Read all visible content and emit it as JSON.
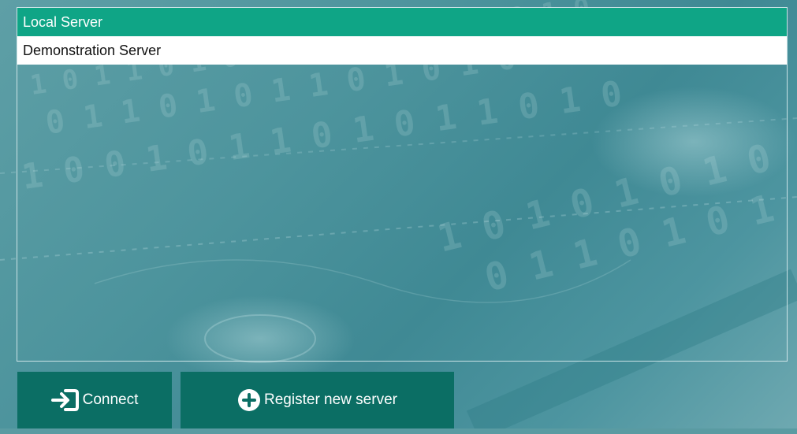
{
  "servers": {
    "items": [
      {
        "label": "Local Server",
        "selected": true
      },
      {
        "label": "Demonstration Server",
        "selected": false
      }
    ]
  },
  "actions": {
    "connect_label": "Connect",
    "connect_icon": "sign-in-icon",
    "register_label": "Register new server",
    "register_icon": "plus-circle-icon"
  },
  "colors": {
    "selected_row": "#0fa586",
    "button_bg": "#0b6e64",
    "background": "#4d949d"
  }
}
